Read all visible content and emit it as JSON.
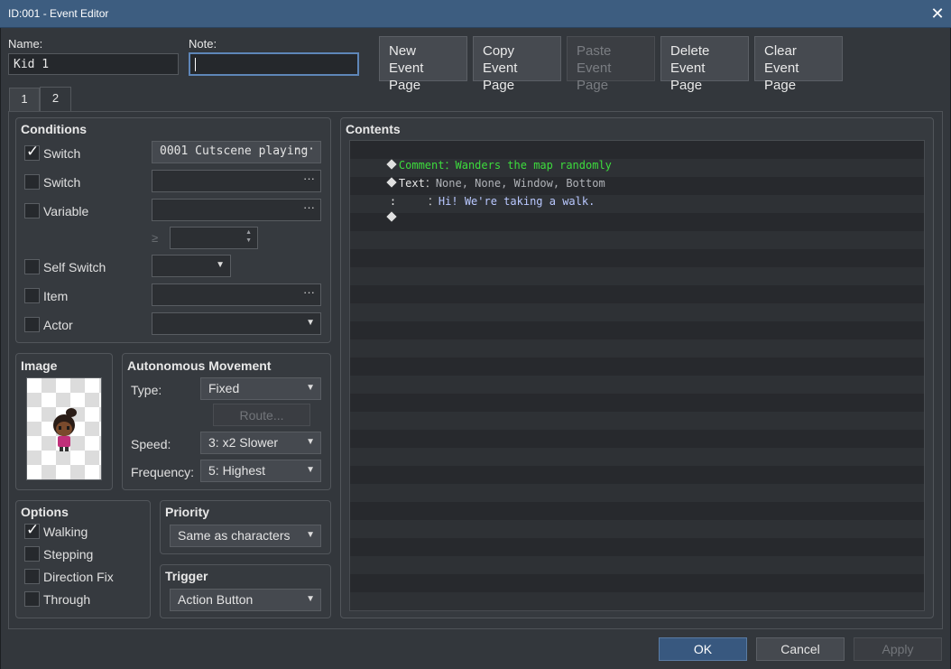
{
  "titlebar": {
    "title": "ID:001 - Event Editor",
    "close": "✕"
  },
  "name": {
    "label": "Name:",
    "value": "Kid 1"
  },
  "note": {
    "label": "Note:",
    "value": ""
  },
  "page_buttons": {
    "new": [
      "New",
      "Event Page"
    ],
    "copy": [
      "Copy",
      "Event Page"
    ],
    "paste": [
      "Paste",
      "Event Page"
    ],
    "delete": [
      "Delete",
      "Event Page"
    ],
    "clear": [
      "Clear",
      "Event Page"
    ]
  },
  "tabs": [
    "1",
    "2"
  ],
  "conditions": {
    "title": "Conditions",
    "switch1": {
      "label": "Switch",
      "checked": true,
      "value": "0001 Cutscene playing"
    },
    "switch2": {
      "label": "Switch",
      "checked": false,
      "value": ""
    },
    "variable": {
      "label": "Variable",
      "checked": false,
      "value": ""
    },
    "ge": "≥",
    "self_switch": {
      "label": "Self Switch",
      "checked": false
    },
    "item": {
      "label": "Item",
      "checked": false
    },
    "actor": {
      "label": "Actor",
      "checked": false
    }
  },
  "image": {
    "title": "Image"
  },
  "movement": {
    "title": "Autonomous Movement",
    "type_label": "Type:",
    "type_value": "Fixed",
    "route": "Route...",
    "speed_label": "Speed:",
    "speed_value": "3: x2 Slower",
    "freq_label": "Frequency:",
    "freq_value": "5: Highest"
  },
  "options": {
    "title": "Options",
    "walking": {
      "label": "Walking",
      "checked": true
    },
    "stepping": {
      "label": "Stepping",
      "checked": false
    },
    "direction_fix": {
      "label": "Direction Fix",
      "checked": false
    },
    "through": {
      "label": "Through",
      "checked": false
    }
  },
  "priority": {
    "title": "Priority",
    "value": "Same as characters"
  },
  "trigger": {
    "title": "Trigger",
    "value": "Action Button"
  },
  "contents": {
    "title": "Contents",
    "line1_cmd": "Comment",
    "line1_sep": "：",
    "line1_text": "Wanders the map randomly",
    "line2_cmd": "Text",
    "line2_sep": "：",
    "line2_text": "None, None, Window, Bottom",
    "line3_prefix": ":",
    "line3_sep": "：",
    "line3_text": "Hi! We're taking a walk."
  },
  "footer": {
    "ok": "OK",
    "cancel": "Cancel",
    "apply": "Apply"
  },
  "colors": {
    "comment": "#3ddc3d",
    "text_body": "#b9c8ff",
    "accent": "#38587f"
  }
}
